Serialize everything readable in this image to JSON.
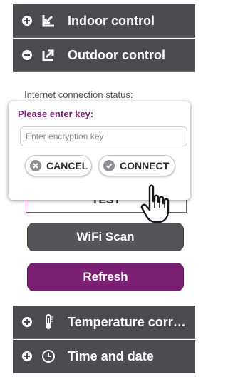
{
  "sections": {
    "indoor": {
      "label": "Indoor control",
      "expanded": false
    },
    "outdoor": {
      "label": "Outdoor control",
      "expanded": true
    },
    "temperature": {
      "label": "Temperature corre…",
      "expanded": false
    },
    "time": {
      "label": "Time and date",
      "expanded": false
    }
  },
  "outdoor_panel": {
    "status_label": "Internet connection status:",
    "test_button_label": "TEST",
    "wifi_scan_label": "WiFi Scan",
    "refresh_label": "Refresh"
  },
  "dialog": {
    "title": "Please enter key:",
    "key_placeholder": "Enter encryption key",
    "key_value": "",
    "cancel_label": "CANCEL",
    "connect_label": "CONNECT"
  },
  "colors": {
    "header_bg": "#4c4c50",
    "accent_purple": "#7a1f74",
    "wifi_button": "#555559"
  },
  "icons": {
    "indoor": "arrow-in-icon",
    "outdoor": "arrow-out-icon",
    "temperature": "thermometer-icon",
    "time": "clock-icon",
    "cursor": "hand-pointer-icon"
  }
}
